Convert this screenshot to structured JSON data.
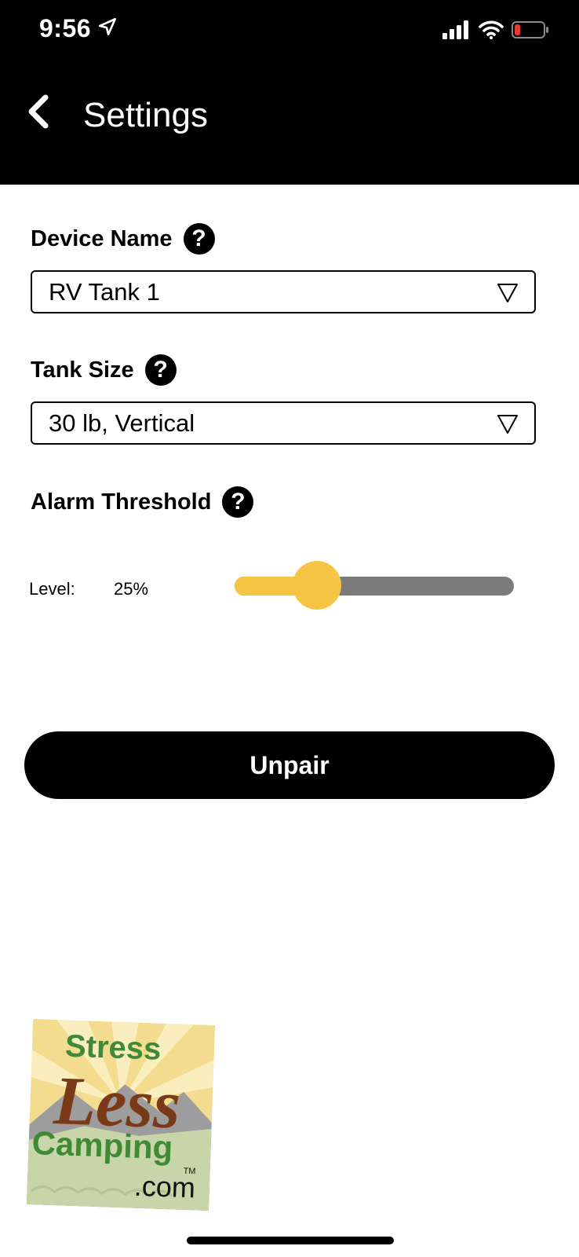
{
  "status_bar": {
    "time": "9:56",
    "icons": [
      "location-arrow-icon",
      "cellular-signal-icon",
      "wifi-icon",
      "battery-low-icon"
    ],
    "battery_color": "#e53935"
  },
  "header": {
    "title": "Settings",
    "back_icon": "chevron-left-icon"
  },
  "device_name": {
    "label": "Device Name",
    "help_icon": "?",
    "value": "RV Tank 1"
  },
  "tank_size": {
    "label": "Tank Size",
    "help_icon": "?",
    "value": "30 lb, Vertical"
  },
  "alarm_threshold": {
    "label": "Alarm Threshold",
    "help_icon": "?",
    "level_label": "Level:",
    "level_value": "25%",
    "level_fraction": 0.25,
    "accent_color": "#f5c543",
    "track_color": "#7b7b7b"
  },
  "actions": {
    "unpair_label": "Unpair"
  },
  "logo": {
    "line1": "Stress",
    "line2": "Less",
    "line3": "Camping",
    "line4": ".com",
    "tm": "TM"
  }
}
